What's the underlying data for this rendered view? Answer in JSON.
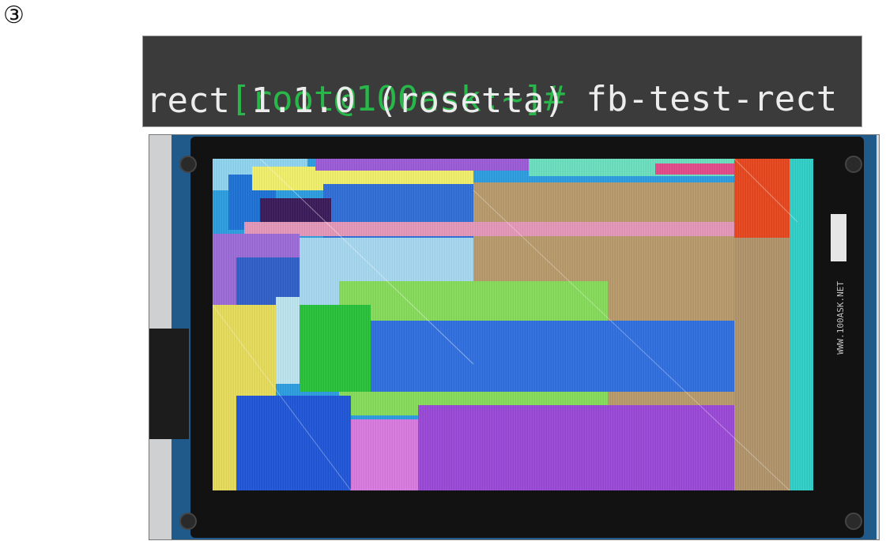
{
  "step_marker": "③",
  "terminal": {
    "prompt": "[root@100ask:~]#",
    "command": "fb-test-rect",
    "output": "rect 1.1.0 (rosetta)"
  },
  "colors": {
    "terminal_bg": "#3b3b3b",
    "prompt_green": "#28b84a",
    "terminal_text": "#ececec"
  },
  "photo": {
    "side_label_text": "WWW.100ASK.NET"
  }
}
